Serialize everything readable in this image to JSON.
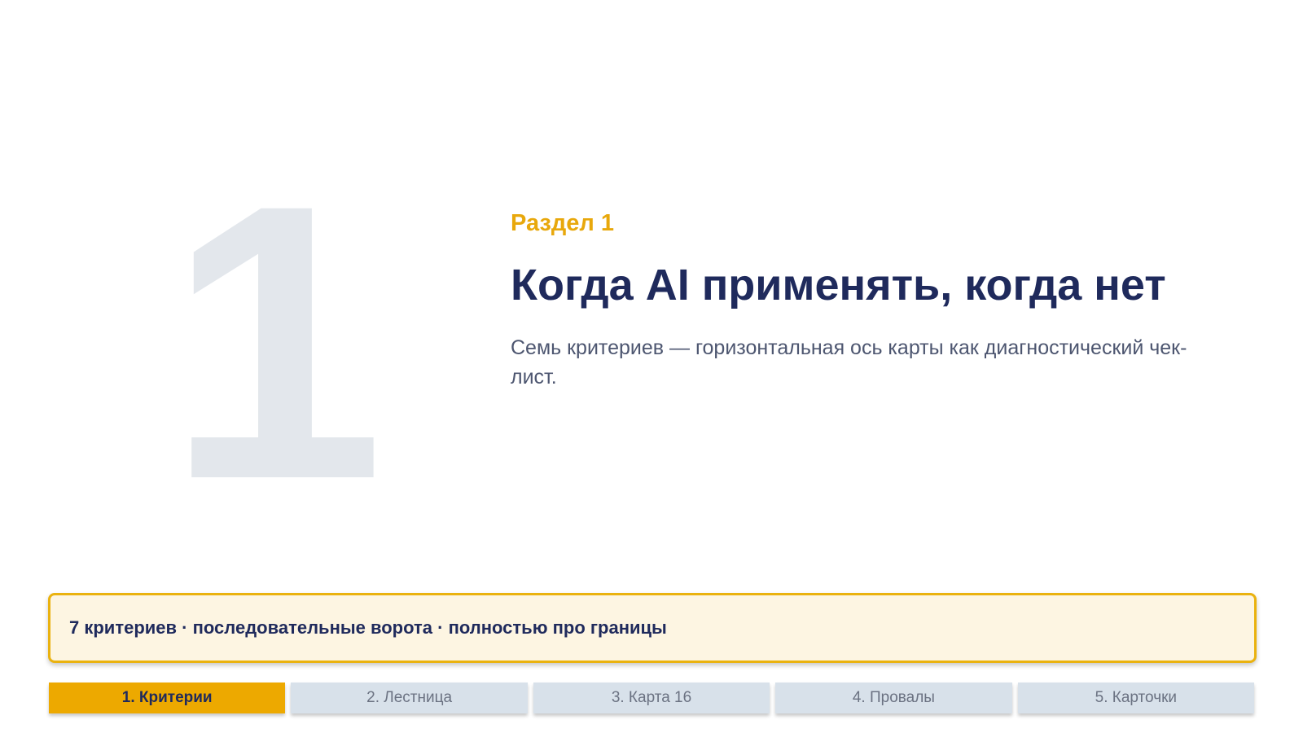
{
  "section": {
    "number": "1",
    "label": "Раздел 1",
    "title": "Когда AI применять, когда нет",
    "subtitle": "Семь критериев — горизонтальная ось карты как диагностический чек-лист."
  },
  "summary": {
    "text": "7 критериев · последовательные ворота · полностью про границы"
  },
  "tabs": [
    {
      "label": "1. Критерии",
      "active": true
    },
    {
      "label": "2. Лестница",
      "active": false
    },
    {
      "label": "3. Карта 16",
      "active": false
    },
    {
      "label": "4. Провалы",
      "active": false
    },
    {
      "label": "5. Карточки",
      "active": false
    }
  ],
  "colors": {
    "accent": "#eda900",
    "title": "#1f2a5c",
    "big_number": "#e3e7ec",
    "tab_inactive": "#d8e1ea",
    "summary_bg": "#fdf5e2"
  }
}
